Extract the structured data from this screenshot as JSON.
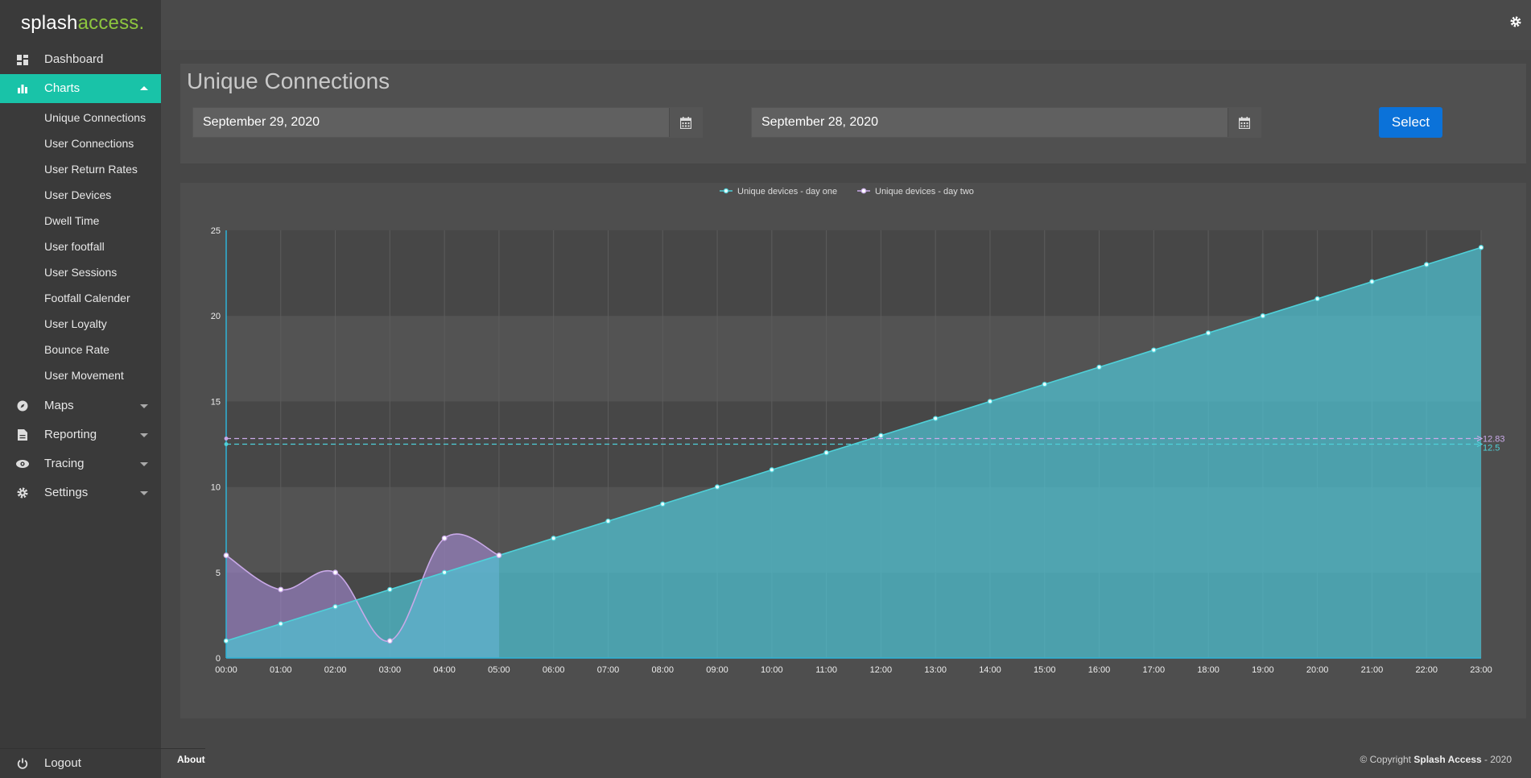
{
  "brand": {
    "part1": "splash",
    "part2": "access."
  },
  "sidebar": {
    "items": [
      {
        "label": "Dashboard",
        "icon": "dashboard-icon"
      },
      {
        "label": "Charts",
        "icon": "bar-chart-icon",
        "active": true
      },
      {
        "label": "Maps",
        "icon": "compass-icon"
      },
      {
        "label": "Reporting",
        "icon": "file-icon"
      },
      {
        "label": "Tracing",
        "icon": "eye-icon"
      },
      {
        "label": "Settings",
        "icon": "gear-icon"
      }
    ],
    "charts_submenu": [
      "Unique Connections",
      "User Connections",
      "User Return Rates",
      "User Devices",
      "Dwell Time",
      "User footfall",
      "User Sessions",
      "Footfall Calender",
      "User Loyalty",
      "Bounce Rate",
      "User Movement"
    ],
    "logout": "Logout"
  },
  "page": {
    "title": "Unique Connections",
    "date_one": "September 29, 2020",
    "date_two": "September 28, 2020",
    "select_label": "Select"
  },
  "footer": {
    "about": "About",
    "copyright_prefix": "© Copyright",
    "copyright_brand": "Splash Access",
    "copyright_suffix": " - 2020"
  },
  "colors": {
    "accent": "#19c3a8",
    "brand_green": "#8dc63f",
    "select_button": "#0b72d9",
    "series_one": "#4fd1d9",
    "series_two": "#c9a9e8"
  },
  "chart_data": {
    "type": "area",
    "x": [
      "00:00",
      "01:00",
      "02:00",
      "03:00",
      "04:00",
      "05:00",
      "06:00",
      "07:00",
      "08:00",
      "09:00",
      "10:00",
      "11:00",
      "12:00",
      "13:00",
      "14:00",
      "15:00",
      "16:00",
      "17:00",
      "18:00",
      "19:00",
      "20:00",
      "21:00",
      "22:00",
      "23:00"
    ],
    "series": [
      {
        "name": "Unique devices - day one",
        "values": [
          1,
          2,
          3,
          4,
          5,
          6,
          7,
          8,
          9,
          10,
          11,
          12,
          13,
          14,
          15,
          16,
          17,
          18,
          19,
          20,
          21,
          22,
          23,
          24
        ],
        "average": 12.5
      },
      {
        "name": "Unique devices - day two",
        "values": [
          6,
          4,
          5,
          1,
          7,
          6
        ],
        "average": 12.83
      }
    ],
    "average_labels": [
      "12.83",
      "12.5"
    ],
    "yticks": [
      0,
      5,
      10,
      15,
      20,
      25
    ],
    "ylim": [
      0,
      25
    ],
    "legend": "top-center",
    "grid": true
  }
}
